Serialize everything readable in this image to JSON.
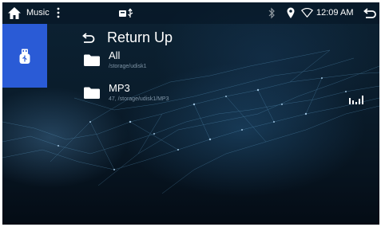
{
  "status_bar": {
    "app_name": "Music",
    "time": "12:09 AM",
    "icons": [
      "home-icon",
      "more-vert-icon",
      "usb-storage-icon",
      "bluetooth-icon",
      "location-icon",
      "wifi-icon",
      "back-icon"
    ]
  },
  "sidebar": {
    "tabs": [
      {
        "icon": "usb-icon",
        "active": true
      }
    ]
  },
  "file_list": {
    "return_up_label": "Return Up",
    "folders": [
      {
        "name": "All",
        "path": "/storage/udisk1"
      },
      {
        "name": "MP3",
        "path": "47, /storage/udisk1/MP3",
        "now_playing": true
      }
    ]
  },
  "colors": {
    "sidebar_active": "#2a5bd6",
    "background": "#0a1c2b",
    "text": "#ffffff",
    "subtext": "#7f94a6"
  }
}
